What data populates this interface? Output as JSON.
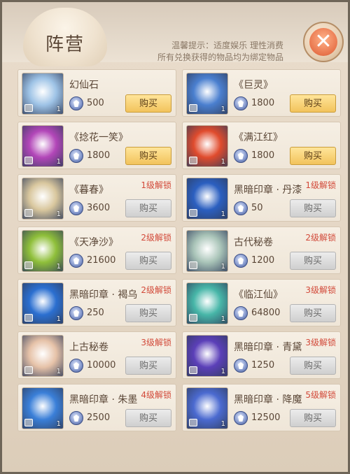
{
  "header": {
    "title": "阵营",
    "tip_line1": "温馨提示：适度娱乐  理性消费",
    "tip_line2": "所有兑换获得的物品均为绑定物品",
    "close_symbol": "✕"
  },
  "items": [
    {
      "name": "幻仙石",
      "price": "500",
      "button": "购买",
      "enabled": true,
      "unlock": "",
      "qty": "1",
      "icon": "gem-icon",
      "color": "#9ec3e6"
    },
    {
      "name": "《巨灵》",
      "price": "1800",
      "button": "购买",
      "enabled": true,
      "unlock": "",
      "qty": "1",
      "icon": "blue-scroll-icon",
      "color": "#4a7fcf"
    },
    {
      "name": "《捻花一笑》",
      "price": "1800",
      "button": "购买",
      "enabled": true,
      "unlock": "",
      "qty": "1",
      "icon": "purple-scroll-icon",
      "color": "#b246b8"
    },
    {
      "name": "《满江红》",
      "price": "1800",
      "button": "购买",
      "enabled": true,
      "unlock": "",
      "qty": "1",
      "icon": "red-scroll-icon",
      "color": "#e04b2d"
    },
    {
      "name": "《暮春》",
      "price": "3600",
      "button": "购买",
      "enabled": false,
      "unlock": "1级解锁",
      "qty": "1",
      "icon": "parchment-icon",
      "color": "#d9c79e"
    },
    {
      "name": "黑暗印章 · 丹漆",
      "price": "50",
      "button": "购买",
      "enabled": false,
      "unlock": "1级解锁",
      "qty": "1",
      "icon": "dark-seal-icon",
      "color": "#2b5fc0"
    },
    {
      "name": "《天净沙》",
      "price": "21600",
      "button": "购买",
      "enabled": false,
      "unlock": "2级解锁",
      "qty": "1",
      "icon": "green-scroll-icon",
      "color": "#8fbf3a"
    },
    {
      "name": "古代秘卷",
      "price": "1200",
      "button": "购买",
      "enabled": false,
      "unlock": "2级解锁",
      "qty": "1",
      "icon": "ancient-scroll-icon",
      "color": "#a9c4b8"
    },
    {
      "name": "黑暗印章 · 褐乌",
      "price": "250",
      "button": "购买",
      "enabled": false,
      "unlock": "2级解锁",
      "qty": "1",
      "icon": "dark-seal-icon",
      "color": "#2b6fd0"
    },
    {
      "name": "《临江仙》",
      "price": "64800",
      "button": "购买",
      "enabled": false,
      "unlock": "3级解锁",
      "qty": "1",
      "icon": "teal-scroll-icon",
      "color": "#47b6a8"
    },
    {
      "name": "上古秘卷",
      "price": "10000",
      "button": "购买",
      "enabled": false,
      "unlock": "3级解锁",
      "qty": "1",
      "icon": "red-ancient-scroll-icon",
      "color": "#e6c2a8"
    },
    {
      "name": "黑暗印章 · 青黛",
      "price": "1250",
      "button": "购买",
      "enabled": false,
      "unlock": "3级解锁",
      "qty": "1",
      "icon": "dark-seal-icon",
      "color": "#5b3fb8"
    },
    {
      "name": "黑暗印章 · 朱墨",
      "price": "2500",
      "button": "购买",
      "enabled": false,
      "unlock": "4级解锁",
      "qty": "1",
      "icon": "dark-seal-icon",
      "color": "#3a7fd8"
    },
    {
      "name": "黑暗印章 · 降魔",
      "price": "12500",
      "button": "购买",
      "enabled": false,
      "unlock": "5级解锁",
      "qty": "1",
      "icon": "dark-seal-icon",
      "color": "#4b6ad0"
    }
  ]
}
